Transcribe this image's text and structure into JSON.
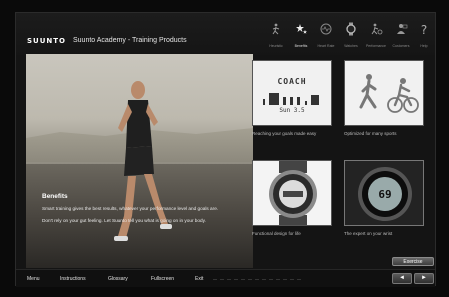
{
  "header": {
    "logo": "SUUNTO",
    "title": "Suunto Academy - Training Products"
  },
  "top_nav": [
    {
      "label": "Heuristic",
      "icon": "running-figure-icon",
      "active": false
    },
    {
      "label": "Benefits",
      "icon": "stars-icon",
      "active": true
    },
    {
      "label": "Heart Rate",
      "icon": "heart-rate-icon",
      "active": false
    },
    {
      "label": "Watches",
      "icon": "watch-icon",
      "active": false
    },
    {
      "label": "Performance",
      "icon": "performance-icon",
      "active": false
    },
    {
      "label": "Customers",
      "icon": "customer-icon",
      "active": false
    },
    {
      "label": "Help",
      "icon": "help-icon",
      "active": false
    }
  ],
  "benefits": {
    "title": "Benefits",
    "paragraph1": "Smart training gives the best results, whatever your performance level and goals are.",
    "paragraph2": "Don't rely on your gut feeling. Let Suunto tell you what is going on in your body."
  },
  "tiles": [
    {
      "caption": "Reaching your goals made easy",
      "screen_word": "COACH",
      "screen_sub": "Sun 3.5"
    },
    {
      "caption": "Optimized for many sports"
    },
    {
      "caption": "Functional design for life"
    },
    {
      "caption": "The expert on your wrist"
    }
  ],
  "exercise_label": "Exercise",
  "footer": {
    "menu": "Menu",
    "instructions": "Instructions",
    "glossary": "Glossary",
    "fullscreen": "Fullscreen",
    "exit": "Exit",
    "prev": "◄",
    "next": "►"
  },
  "colors": {
    "background": "#0a0a0a",
    "window": "#141414",
    "accent_text": "#ffffff"
  }
}
